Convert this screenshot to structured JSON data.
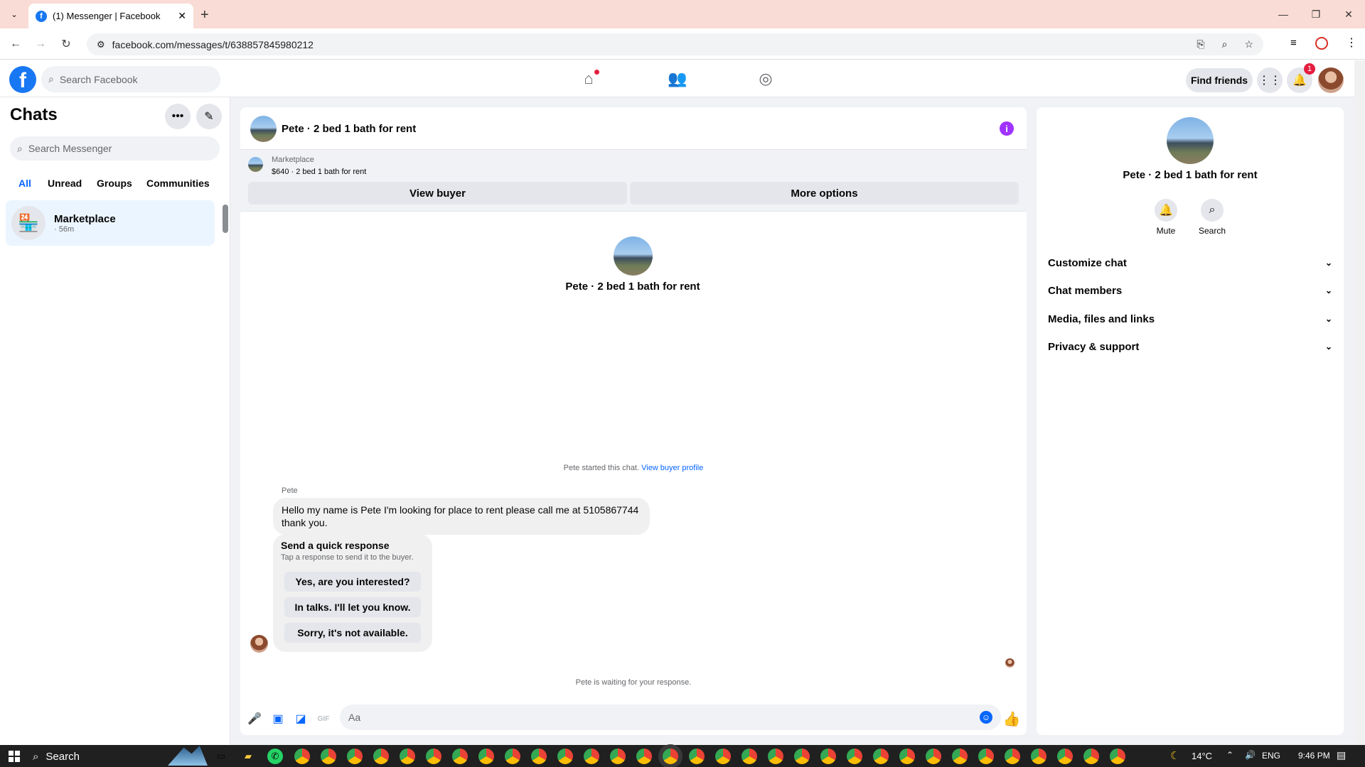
{
  "browser": {
    "tab_title": "(1) Messenger | Facebook",
    "url": "facebook.com/messages/t/638857845980212"
  },
  "fb": {
    "search_placeholder": "Search Facebook",
    "find_friends": "Find friends",
    "notif_count": "1"
  },
  "sidebar": {
    "title": "Chats",
    "search_placeholder": "Search Messenger",
    "filters": [
      "All",
      "Unread",
      "Groups",
      "Communities"
    ],
    "chat": {
      "name": "Marketplace",
      "time": "· 56m"
    }
  },
  "convo": {
    "header_name": "Pete · 2 bed 1 bath for rent",
    "listing_label": "Marketplace",
    "listing_price_title": "$640 · 2 bed 1 bath for rent",
    "view_buyer": "View buyer",
    "more_options": "More options",
    "profile_name": "Pete · 2 bed 1 bath for rent",
    "started_text": "Pete started this chat.",
    "view_buyer_profile": "View buyer profile",
    "sender": "Pete",
    "message": "Hello my name is Pete I'm looking for place to rent please call me at 5105867744 thank you.",
    "quick_title": "Send a quick response",
    "quick_sub": "Tap a response to send it to the buyer.",
    "quick_replies": [
      "Yes, are you interested?",
      "In talks. I'll let you know.",
      "Sorry, it's not available."
    ],
    "waiting": "Pete is waiting for your response.",
    "composer_placeholder": "Aa"
  },
  "details": {
    "name": "Pete · 2 bed 1 bath for rent",
    "mute": "Mute",
    "search": "Search",
    "sections": [
      "Customize chat",
      "Chat members",
      "Media, files and links",
      "Privacy & support"
    ]
  },
  "taskbar": {
    "search": "Search",
    "temp": "14°C",
    "lang": "ENG",
    "time": "9:46 PM"
  },
  "colors": {
    "fb_blue": "#1877f2",
    "messenger_blue": "#0866ff",
    "info_purple": "#a033ff",
    "tab_strip": "#f9dcd5"
  }
}
